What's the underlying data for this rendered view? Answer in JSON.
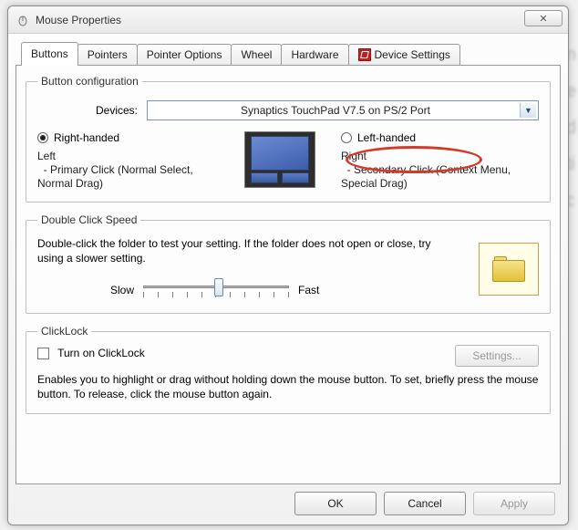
{
  "window": {
    "title": "Mouse Properties",
    "close_glyph": "✕"
  },
  "tabs": {
    "buttons": "Buttons",
    "pointers": "Pointers",
    "pointer_options": "Pointer Options",
    "wheel": "Wheel",
    "hardware": "Hardware",
    "device_settings": "Device Settings"
  },
  "button_config": {
    "legend": "Button configuration",
    "devices_label": "Devices:",
    "device_selected": "Synaptics TouchPad V7.5 on PS/2 Port",
    "right_handed": "Right-handed",
    "left_handed": "Left-handed",
    "left_heading": "Left",
    "left_desc": "  - Primary Click (Normal Select, Normal Drag)",
    "right_heading": "Right",
    "right_desc": "  - Secondary Click (Context Menu, Special Drag)"
  },
  "double_click": {
    "legend": "Double Click Speed",
    "text": "Double-click the folder to test your setting.  If the folder does not open or close, try using a slower setting.",
    "slow": "Slow",
    "fast": "Fast"
  },
  "clicklock": {
    "legend": "ClickLock",
    "checkbox_label": "Turn on ClickLock",
    "settings_button": "Settings...",
    "text": "Enables you to highlight or drag without holding down the mouse button.  To set, briefly press the mouse button.  To release, click the mouse button again."
  },
  "footer": {
    "ok": "OK",
    "cancel": "Cancel",
    "apply": "Apply"
  }
}
